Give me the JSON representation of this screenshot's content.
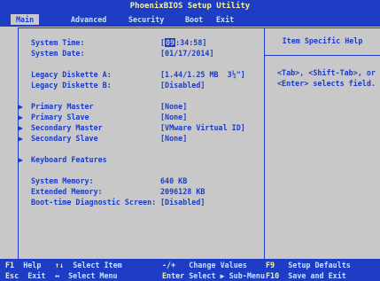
{
  "title": "PhoenixBIOS Setup Utility",
  "tabs": [
    {
      "label": "Main"
    },
    {
      "label": "Advanced"
    },
    {
      "label": "Security"
    },
    {
      "label": "Boot"
    },
    {
      "label": "Exit"
    }
  ],
  "fields": {
    "system_time": {
      "label": "System Time:",
      "value_prefix": "[",
      "value_hl": "09",
      "value_suffix": ":34:58]"
    },
    "system_date": {
      "label": "System Date:",
      "value": "[01/17/2014]"
    },
    "legacy_a": {
      "label": "Legacy Diskette A:",
      "value": "[1.44/1.25 MB  3½\"]"
    },
    "legacy_b": {
      "label": "Legacy Diskette B:",
      "value": "[Disabled]"
    },
    "primary_master": {
      "label": "Primary Master",
      "value": "[None]"
    },
    "primary_slave": {
      "label": "Primary Slave",
      "value": "[None]"
    },
    "secondary_master": {
      "label": "Secondary Master",
      "value": "[VMware Virtual ID]"
    },
    "secondary_slave": {
      "label": "Secondary Slave",
      "value": "[None]"
    },
    "keyboard_features": {
      "label": "Keyboard Features"
    },
    "system_memory": {
      "label": "System Memory:",
      "value": "640 KB"
    },
    "extended_memory": {
      "label": "Extended Memory:",
      "value": "2096128 KB"
    },
    "boot_diag": {
      "label": "Boot-time Diagnostic Screen:",
      "value": "[Disabled]"
    }
  },
  "help": {
    "title": "Item Specific Help",
    "text": "<Tab>, <Shift-Tab>, or\n<Enter> selects field."
  },
  "keys": {
    "row1": [
      {
        "key": "F1",
        "desc": "Help"
      },
      {
        "key": "↑↓",
        "desc": "Select Item"
      },
      {
        "key": "-/+",
        "desc": "Change Values"
      },
      {
        "key": "F9",
        "desc": "Setup Defaults"
      }
    ],
    "row2": [
      {
        "key": "Esc",
        "desc": "Exit"
      },
      {
        "key": "↔",
        "desc": "Select Menu"
      },
      {
        "key": "Enter",
        "desc": "Select ▶ Sub-Menu"
      },
      {
        "key": "F10",
        "desc": "Save and Exit"
      }
    ]
  },
  "colors": {
    "bios_blue": "#1e3cc4",
    "bios_gray": "#c8c8c8",
    "header_text": "#f4f4a0"
  },
  "icons": {
    "submenu_arrow": "submenu-arrow-icon"
  }
}
